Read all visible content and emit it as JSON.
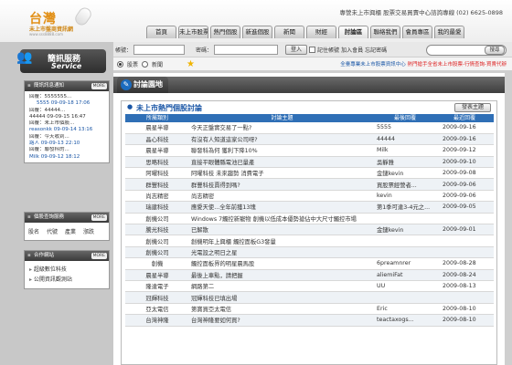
{
  "header": {
    "logo_line1": "台灣",
    "logo_line2": "未上市盤商資訊網",
    "logo_line3": "www.sss8888.com",
    "phone_text": "專營未上市興櫃 股票交易買賣中心諮詢專線 (02) 6625-0898",
    "nav": [
      "首頁",
      "未上市股票",
      "熱門個股",
      "新進個股",
      "新聞",
      "財經",
      "討論區",
      "聯絡我們",
      "會員專區",
      "我的最愛"
    ],
    "active_nav_index": 6
  },
  "bar": {
    "account_label": "帳號：",
    "password_label": "密碼：",
    "login_button": "登入",
    "remember_label": "記住帳號",
    "join_link": "加入會員",
    "forgot_link": "忘記密碼",
    "search_button": "搜尋"
  },
  "bar2": {
    "radio_stock": "股票",
    "radio_news": "新聞",
    "promo_main": "全臺專業未上市股票資訊中心",
    "promo_sub": "熱門搶手全省未上市股票-行情查詢-買賣代辦"
  },
  "sidebar": {
    "brand_line1": "簡訊服務",
    "brand_line2": "Service",
    "news_box": {
      "title": "簡訊訊息通知",
      "more": "MORE",
      "items": [
        {
          "text": "回覆：5555555...",
          "cls": ""
        },
        {
          "text": "5555 09-09-18 17:06",
          "cls": "sub"
        },
        {
          "text": "回覆：44444...",
          "cls": ""
        },
        {
          "text": "44444 09-09-15 16:47",
          "cls": ""
        },
        {
          "text": "回覆：未上市個股...",
          "cls": ""
        },
        {
          "text": "reasonkk 09-09-14 13:16",
          "cls": "hl"
        },
        {
          "text": "回覆：今天收到...",
          "cls": ""
        },
        {
          "text": "路人 09-09-13 22:10",
          "cls": "hl"
        },
        {
          "text": "回覆：聯發科的...",
          "cls": ""
        },
        {
          "text": "Milk 09-09-12 18:12",
          "cls": "hl"
        }
      ]
    },
    "query_box": {
      "title": "個股查詢服務",
      "more": "MORE",
      "links": [
        "股名",
        "代號",
        "產業",
        "漲跌"
      ]
    },
    "links_box": {
      "title": "合作網站",
      "more": "MORE",
      "items": [
        "超級數位科技",
        "公開資訊觀測站"
      ]
    }
  },
  "main": {
    "section_title": "討論園地",
    "panel_title": "未上市熱門個股討論",
    "new_topic_button": "發表主題",
    "columns": [
      "所屬類別",
      "討論主題",
      "最後回覆",
      "最近回覆"
    ],
    "rows": [
      [
        "晨星半導",
        "今天正盤實交易了一點?",
        "5555",
        "2009-09-16"
      ],
      [
        "晶心科技",
        "有沒有人知道這家公司呀?",
        "44444",
        "2009-09-16"
      ],
      [
        "晨星半導",
        "聯發科為何 獲利下降10%",
        "Milk",
        "2009-09-12"
      ],
      [
        "思略科技",
        "直接平眼體縣電池已量產",
        "吳靜雅",
        "2009-09-10"
      ],
      [
        "阿曜科技",
        "阿曜科技 未來趨勢 消費電子",
        "金鏈kevin",
        "2009-09-08"
      ],
      [
        "群豐科技",
        "群豐科技賣得到嗎?",
        "買股票經營者...",
        "2009-09-06"
      ],
      [
        "尚志精密",
        "尚志精密",
        "kevin",
        "2009-09-06"
      ],
      [
        "瑞建科技",
        "應愛天使...全年前獲13塊",
        "第1季可達3-4元之...",
        "2009-09-05"
      ],
      [
        "創機公司",
        "Windows 7觸控新寵物 創機以低成本優勢搶佔中大尺寸觸控市場",
        "",
        ""
      ],
      [
        "騰光科技",
        "已解散",
        "金鏈kevin",
        "2009-09-01"
      ],
      [
        "創機公司",
        "創機明年上興櫃 觸控面板G3發量",
        "",
        ""
      ],
      [
        "創機公司",
        "光電設之明日之星",
        "",
        ""
      ],
      [
        "創機",
        "觸控面板界的明星晨馬股",
        "6preamnrer",
        "2009-08-28"
      ],
      [
        "晨星半導",
        "最後上車點，請把握",
        "aliemiFat",
        "2009-08-24"
      ],
      [
        "隆達電子",
        "網路第二",
        "UU",
        "2009-08-13"
      ],
      [
        "冠輝科技",
        "冠輝科技已填出場",
        "",
        ""
      ],
      [
        "亞太電信",
        "第寶買亞太電信",
        "Eric",
        "2009-08-10"
      ],
      [
        "台灣神隆",
        "台灣神隆要如何買?",
        "teactaxogs...",
        "2009-08-10"
      ]
    ]
  }
}
